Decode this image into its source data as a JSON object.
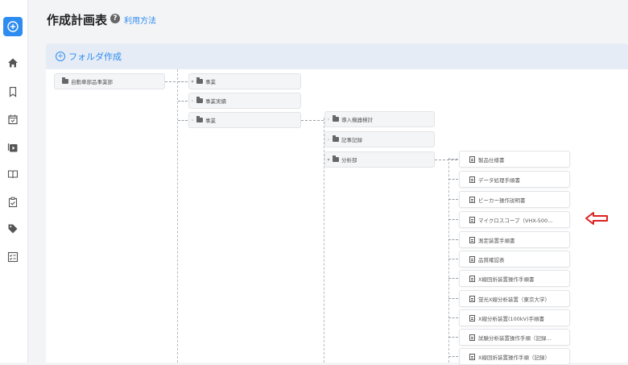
{
  "header": {
    "title": "作成計画表",
    "help_icon": "question-circle-icon",
    "help_link": "利用方法"
  },
  "toolbar": {
    "create_folder": "フォルダ作成",
    "plus_icon": "plus-circle-icon"
  },
  "sidebar": {
    "add_icon": "plus-circle-icon",
    "icons": [
      "home-icon",
      "bookmark-icon",
      "calendar-check-icon",
      "play-square-icon",
      "book-open-icon",
      "clipboard-check-icon",
      "tag-icon",
      "checklist-icon"
    ]
  },
  "tree": {
    "root": "自動車部品事業部",
    "level1": [
      "事業",
      "事業実績",
      "事業"
    ],
    "level2": [
      "導入機器検討",
      "記事記録",
      "分析部"
    ],
    "docs": [
      "製品仕様書",
      "データ処理手順書",
      "ビーカー操作説明書",
      "マイクロスコープ（VHX-500…",
      "測定装置手順書",
      "品質確認表",
      "X線回折装置操作手順書",
      "蛍光X線分析装置（東京大学）",
      "X線分析装置(100kV)手順書",
      "試験分析装置操作手順（記録…",
      "X線回折装置操作手順（記録）"
    ]
  },
  "colors": {
    "accent": "#2d8cf0",
    "highlight_arrow": "#e02020"
  }
}
